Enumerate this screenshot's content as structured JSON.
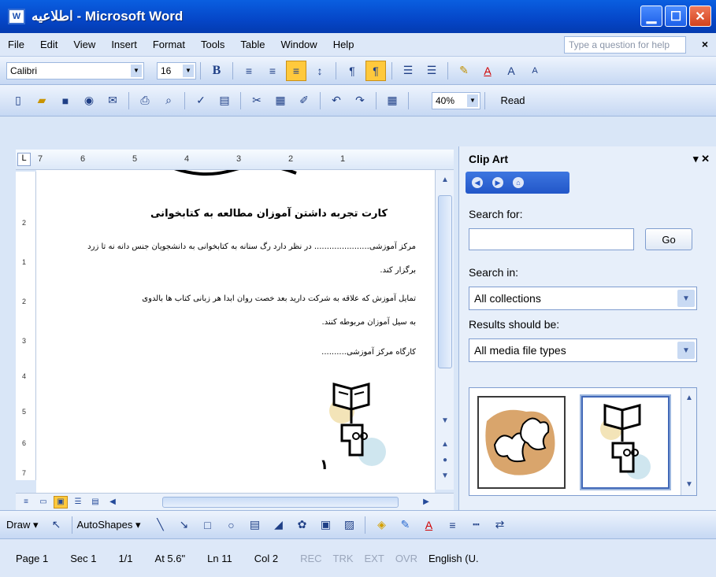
{
  "window": {
    "title": "اطلاعیه - Microsoft Word",
    "buttons": [
      "minimize",
      "maximize",
      "close"
    ]
  },
  "menubar": {
    "items": [
      "File",
      "Edit",
      "View",
      "Insert",
      "Format",
      "Tools",
      "Table",
      "Window",
      "Help"
    ],
    "question_placeholder": "Type a question for help",
    "close_label": "×"
  },
  "formatting_toolbar": {
    "font": "Calibri",
    "size": "16",
    "bold_label": "B"
  },
  "standard_toolbar": {
    "zoom": "40%",
    "read_label": "Read"
  },
  "ruler": {
    "horizontal_marks": [
      "7",
      "6",
      "5",
      "4",
      "3",
      "2",
      "1"
    ],
    "vertical_marks": [
      "2",
      "1",
      "2",
      "3",
      "4",
      "5",
      "6",
      "7"
    ]
  },
  "document": {
    "heading": "کارت تجربه داشتن آموزان مطالعه به کتابخوانی",
    "paragraphs": [
      "مرکز آموزشی...................... در نظر دارد رگ سنانه به کتابخوانی به دانشجویان جنس دانه نه تا زرد",
      "برگزار کند.",
      "تمایل آموزش که علاقه به شرکت دارید بعد خصت روان ابدا هر زبانی کتاب ها بالدوی",
      "به سیل آموزان مربوطه کنند.",
      "کارگاه مرکز آموزشی.........."
    ],
    "page_number": "۱"
  },
  "clipart_pane": {
    "title": "Clip Art",
    "search_for_label": "Search for:",
    "search_value": "",
    "go_label": "Go",
    "search_in_label": "Search in:",
    "search_in_value": "All collections",
    "results_label": "Results should be:",
    "results_value": "All media file types",
    "results": [
      "leaves-clipart",
      "book-reader-clipart"
    ]
  },
  "drawing_toolbar": {
    "draw_label": "Draw",
    "autoshapes_label": "AutoShapes"
  },
  "statusbar": {
    "page": "Page 1",
    "section": "Sec 1",
    "pages": "1/1",
    "at": "At 5.6\"",
    "line": "Ln 11",
    "column": "Col 2",
    "rec": "REC",
    "trk": "TRK",
    "ext": "EXT",
    "ovr": "OVR",
    "language": "English (U."
  }
}
